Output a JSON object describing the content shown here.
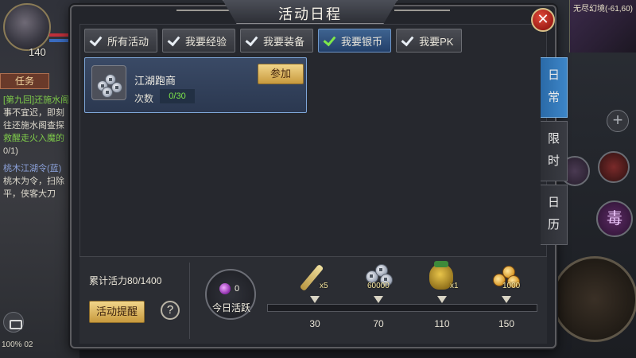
{
  "hud": {
    "level": "140",
    "task_tab": "任务",
    "tasks": [
      "[第九回]还施水阁",
      "事不宜迟，即刻",
      "往还施水阁查探",
      "救醒走火入魔的",
      "0/1)",
      "桃木江湖令(蓝)",
      "桃木为令，扫除",
      "平，侠客大刀"
    ],
    "status": "100% 02",
    "map_label": "无尽幻境(-61,60)",
    "poison_skill": "毒"
  },
  "dialog": {
    "title": "活动日程",
    "close_icon": "close-icon",
    "filters": [
      {
        "label": "所有活动",
        "active": false
      },
      {
        "label": "我要经验",
        "active": false
      },
      {
        "label": "我要装备",
        "active": false
      },
      {
        "label": "我要银币",
        "active": true
      },
      {
        "label": "我要PK",
        "active": false
      }
    ],
    "activity": {
      "name": "江湖跑商",
      "count_label": "次数",
      "count_value": "0/30",
      "join_label": "参加",
      "icon": "silver-coins-icon"
    },
    "side_tabs": [
      {
        "chars": [
          "日",
          "常"
        ],
        "active": true
      },
      {
        "chars": [
          "限",
          "时"
        ],
        "active": false
      },
      {
        "chars": [
          "日",
          "历"
        ],
        "active": false
      }
    ],
    "bottom": {
      "vitality_text": "累计活力80/1400",
      "remind_label": "活动提醒",
      "help_symbol": "?",
      "today_value": "0",
      "today_label": "今日活跃",
      "milestones": [
        {
          "threshold": "30",
          "reward_qty": "x5",
          "reward": "scroll-icon"
        },
        {
          "threshold": "70",
          "reward_qty": "60000",
          "reward": "silver-coins-icon"
        },
        {
          "threshold": "110",
          "reward_qty": "x1",
          "reward": "money-bag-icon"
        },
        {
          "threshold": "150",
          "reward_qty": "1000",
          "reward": "gold-coins-icon"
        }
      ]
    }
  },
  "colors": {
    "active_tab": "#2a5a90",
    "accent_gold": "#d9ae56",
    "count_green": "#7ee84a"
  }
}
